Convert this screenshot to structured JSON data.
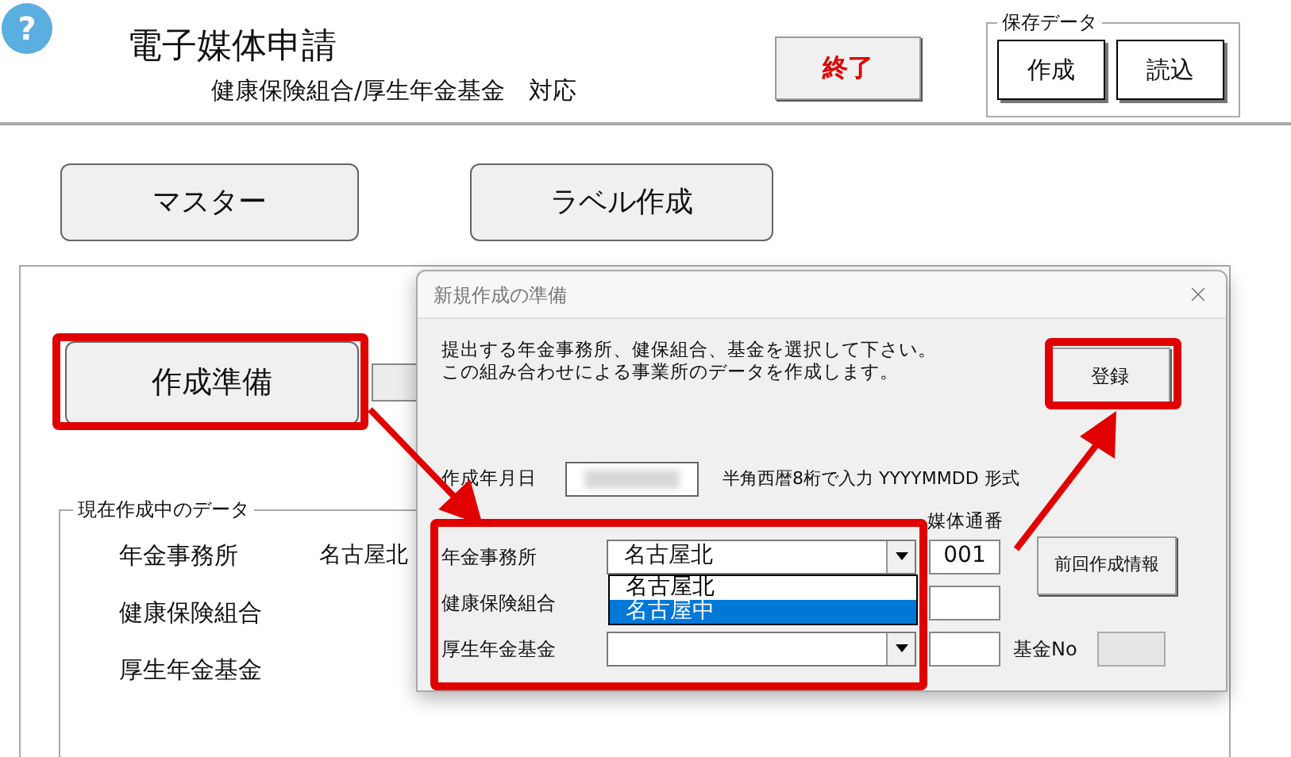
{
  "header": {
    "help_icon": "?",
    "title": "電子媒体申請",
    "subtitle": "健康保険組合/厚生年金基金　対応",
    "exit_button": "終了",
    "save_group": {
      "label": "保存データ",
      "buttons": [
        "作成",
        "読込"
      ]
    }
  },
  "nav_buttons": [
    "マスター",
    "ラベル作成"
  ],
  "prepare_button": "作成準備",
  "current_data": {
    "label": "現在作成中のデータ",
    "rows": [
      {
        "label": "年金事務所",
        "value": "名古屋北"
      },
      {
        "label": "健康保険組合"
      },
      {
        "label": "厚生年金基金"
      }
    ]
  },
  "dialog": {
    "title": "新規作成の準備",
    "instructions": [
      "提出する年金事務所、健保組合、基金を選択して下さい。",
      "この組み合わせによる事業所のデータを作成します。"
    ],
    "register_button": "登録",
    "date": {
      "label": "作成年月日",
      "hint": "半角西暦8桁で入力  YYYYMMDD 形式"
    },
    "serial_label": "媒体通番",
    "previous_button": "前回作成情報",
    "rows": [
      {
        "label": "年金事務所",
        "kind": "combo",
        "value": "名古屋北",
        "serial": "001",
        "open": true,
        "options": [
          {
            "label": "名古屋北",
            "highlighted": false
          },
          {
            "label": "名古屋中",
            "highlighted": true
          }
        ]
      },
      {
        "label": "健康保険組合",
        "kind": "covered"
      },
      {
        "label": "厚生年金基金",
        "kind": "combo",
        "extra_label": "基金No"
      }
    ]
  }
}
